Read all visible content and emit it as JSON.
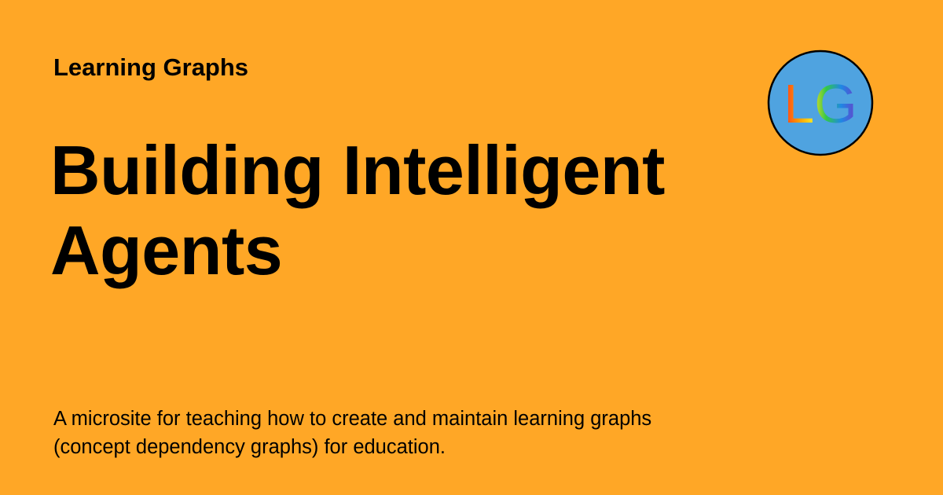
{
  "site": {
    "name": "Learning Graphs"
  },
  "page": {
    "title_line1": "Building Intelligent",
    "title_line2": "Agents",
    "description": "A microsite for teaching how to create and maintain learning graphs (concept dependency graphs) for education."
  },
  "logo": {
    "letters": "LG",
    "circle_color": "#4FA3E0",
    "background_color": "#FFA726"
  }
}
